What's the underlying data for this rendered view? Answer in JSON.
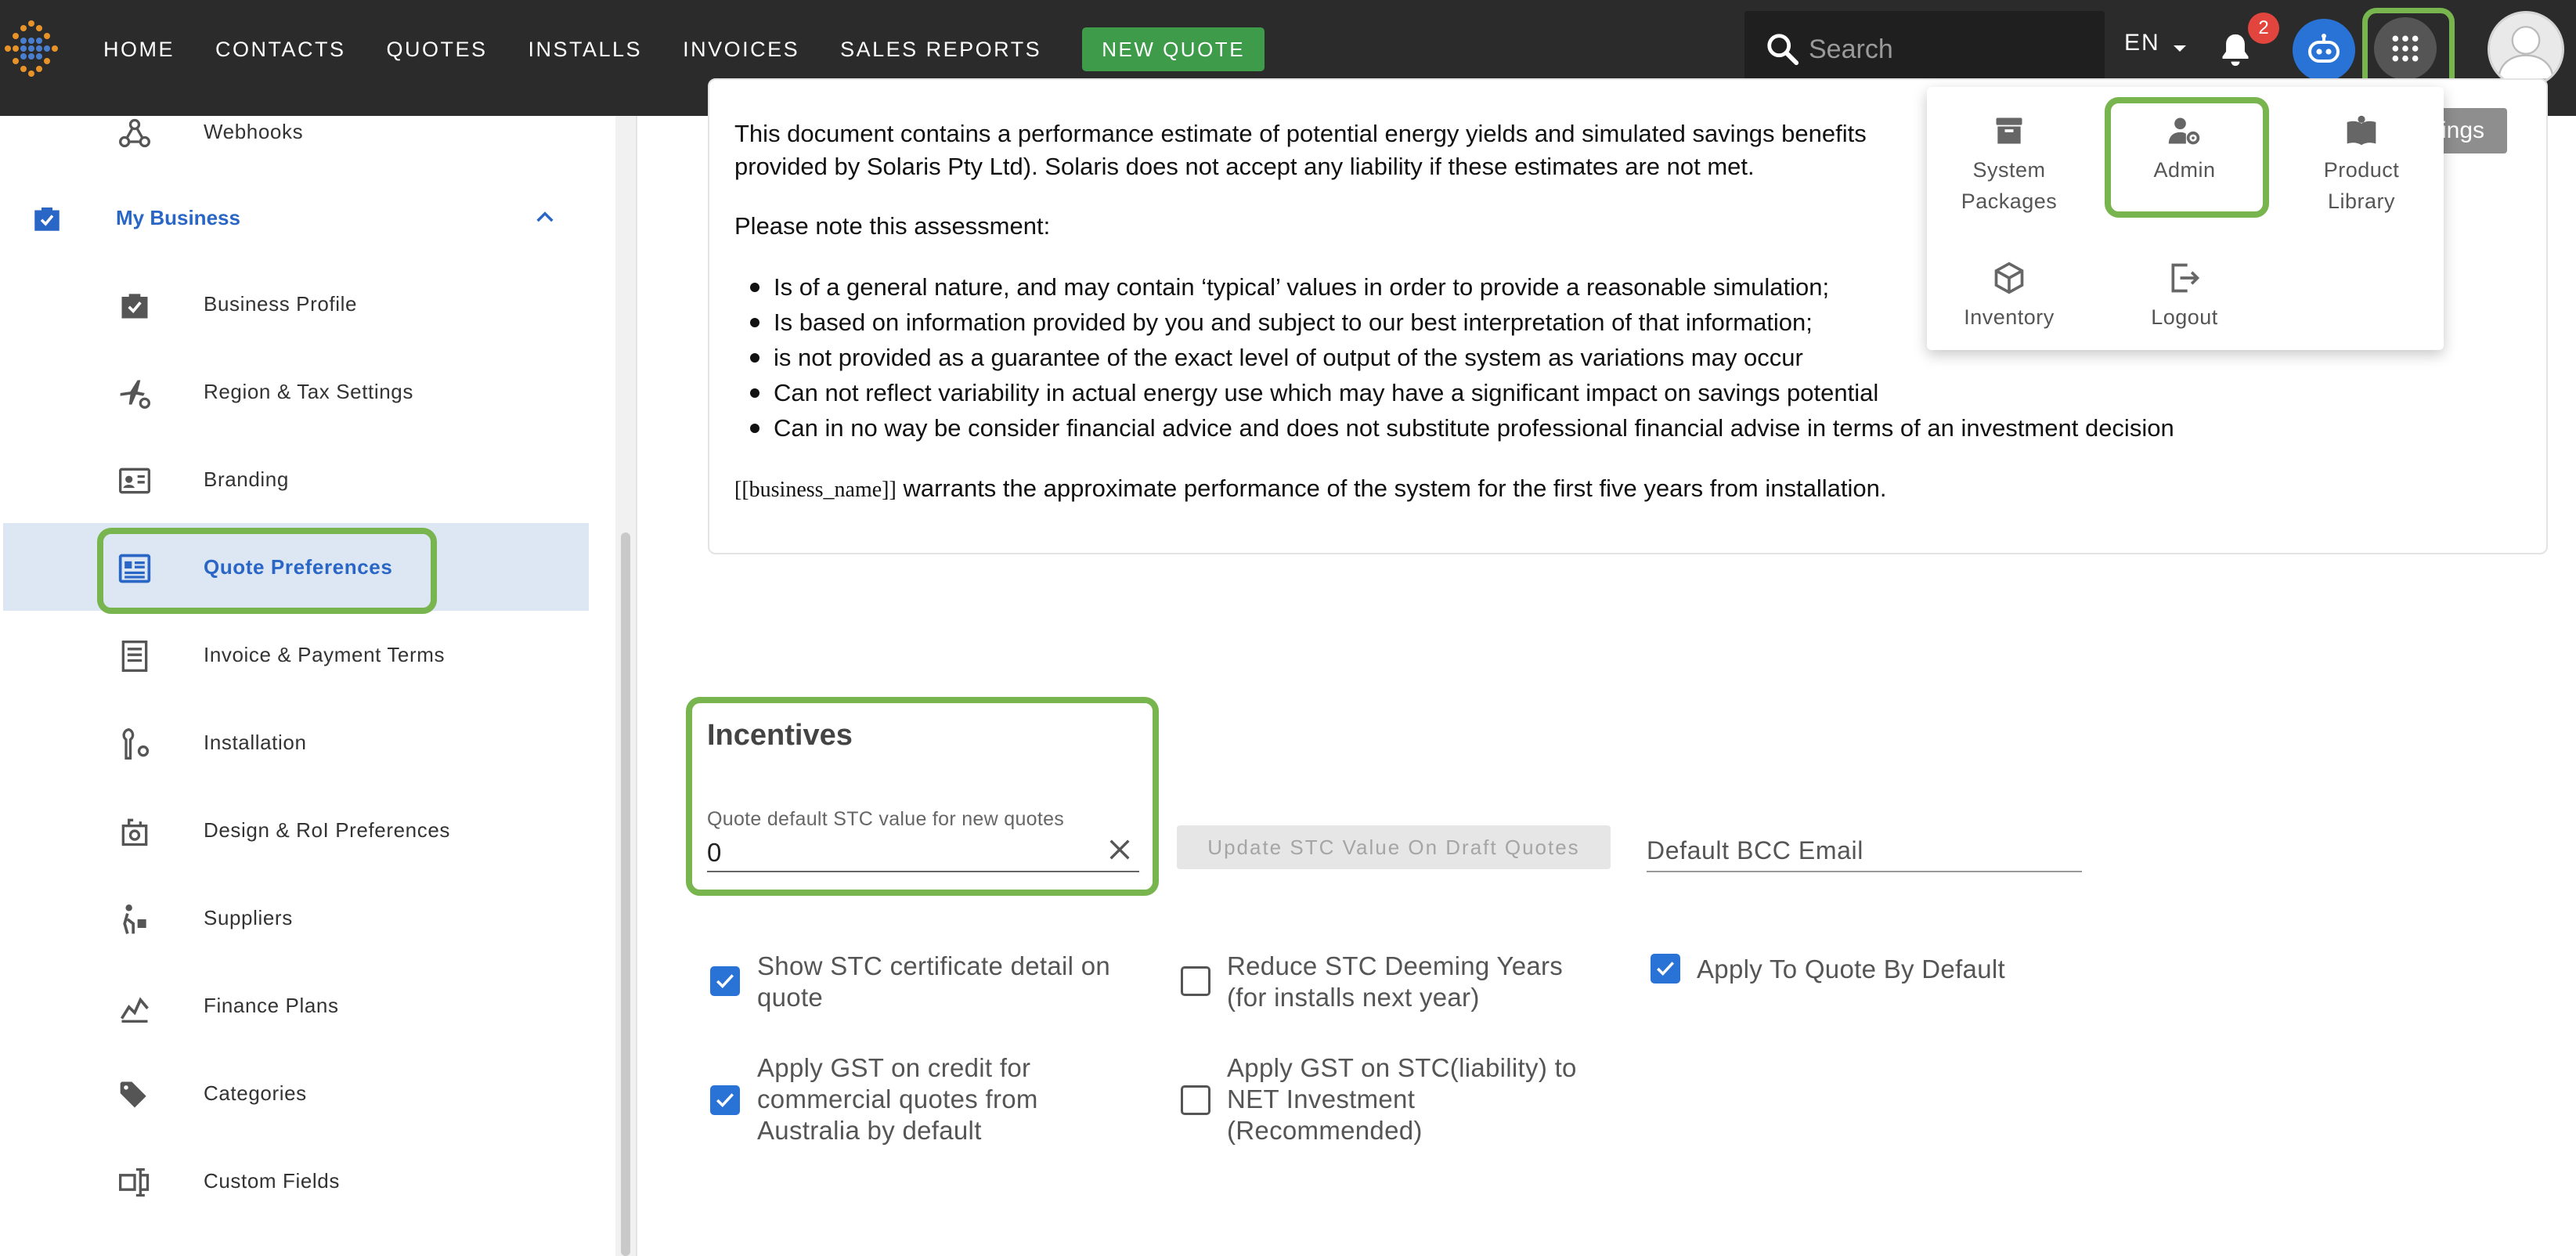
{
  "nav": {
    "items": [
      "HOME",
      "CONTACTS",
      "QUOTES",
      "INSTALLS",
      "INVOICES",
      "SALES REPORTS"
    ],
    "new_quote": "NEW QUOTE"
  },
  "search": {
    "placeholder": "Search"
  },
  "lang": "EN",
  "notifications": {
    "count": "2"
  },
  "colors": {
    "accent": "#3e9b4a",
    "highlight": "#78b54e",
    "link": "#2a66c5",
    "active_bg": "#dde7f3",
    "topbar": "#2b2b2b"
  },
  "sidebar": {
    "top_item": "Webhooks",
    "section": "My Business",
    "items": [
      {
        "label": "Business Profile",
        "icon": "briefcase-icon"
      },
      {
        "label": "Region & Tax Settings",
        "icon": "plane-gear-icon"
      },
      {
        "label": "Branding",
        "icon": "id-card-icon"
      },
      {
        "label": "Quote Preferences",
        "icon": "document-list-icon"
      },
      {
        "label": "Invoice & Payment Terms",
        "icon": "receipt-icon"
      },
      {
        "label": "Installation",
        "icon": "wrench-gear-icon"
      },
      {
        "label": "Design & RoI Preferences",
        "icon": "design-icon"
      },
      {
        "label": "Suppliers",
        "icon": "dolly-icon"
      },
      {
        "label": "Finance Plans",
        "icon": "chart-icon"
      },
      {
        "label": "Categories",
        "icon": "tags-icon"
      },
      {
        "label": "Custom Fields",
        "icon": "custom-fields-icon"
      }
    ]
  },
  "document": {
    "para1_line1": "This document contains a performance estimate of potential energy yields and simulated savings benefits",
    "para1_line2": "provided by Solaris Pty Ltd). Solaris does not accept any liability if these estimates are not met.",
    "para2": "Please note this assessment:",
    "bullets": [
      "Is of a general nature, and may contain ‘typical’ values in order to provide a reasonable simulation;",
      "Is based on information provided by you and subject to our best interpretation of that information;",
      "is not provided as a guarantee of the exact level of output of the system as variations may occur",
      "Can not reflect variability in actual energy use which may have a significant impact on savings potential",
      "Can in no way be consider financial advice and does not substitute professional financial advise in terms of an investment decision"
    ],
    "warrant_var": "[[business_name]]",
    "warrant_text": " warrants the approximate performance of the system for the first five years from installation.",
    "side_button_fragment": "ings"
  },
  "apps_menu": {
    "items": [
      {
        "label": "System Packages",
        "icon": "package-icon"
      },
      {
        "label": "Admin",
        "icon": "admin-gear-icon"
      },
      {
        "label": "Product Library",
        "icon": "book-icon"
      },
      {
        "label": "Inventory",
        "icon": "box-icon"
      },
      {
        "label": "Logout",
        "icon": "logout-icon"
      }
    ]
  },
  "incentives": {
    "title": "Incentives",
    "stc_label": "Quote default STC value for new quotes",
    "stc_value": "0",
    "update_button": "Update STC Value On Draft Quotes",
    "bcc_placeholder": "Default BCC Email",
    "checkboxes": [
      {
        "label_l1": "Show STC certificate detail on",
        "label_l2": "quote",
        "label_l3": "",
        "checked": true
      },
      {
        "label_l1": "Reduce STC Deeming Years",
        "label_l2": "(for installs next year)",
        "label_l3": "",
        "checked": false
      },
      {
        "label_l1": "Apply To Quote By Default",
        "label_l2": "",
        "label_l3": "",
        "checked": true
      },
      {
        "label_l1": "Apply GST on credit for",
        "label_l2": "commercial quotes from",
        "label_l3": "Australia by default",
        "checked": true
      },
      {
        "label_l1": "Apply GST on STC(liability) to",
        "label_l2": "NET Investment",
        "label_l3": "(Recommended)",
        "checked": false
      }
    ]
  }
}
